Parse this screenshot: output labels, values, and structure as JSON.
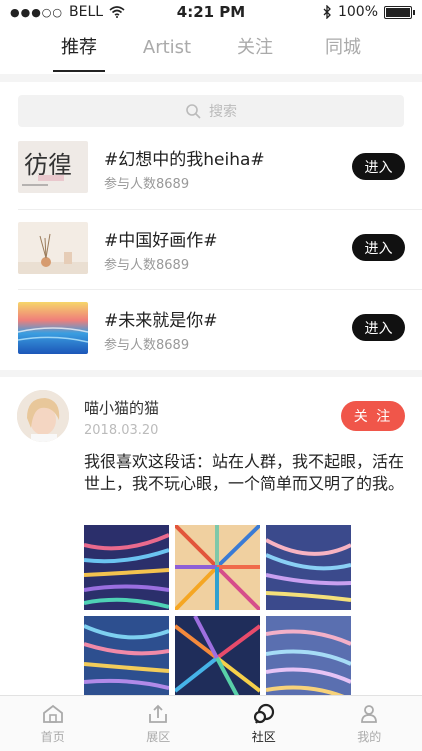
{
  "status": {
    "carrier": "BELL",
    "time": "4:21 PM",
    "battery": "100%"
  },
  "tabs": [
    {
      "label": "推荐",
      "active": true
    },
    {
      "label": "Artist",
      "active": false
    },
    {
      "label": "关注",
      "active": false
    },
    {
      "label": "同城",
      "active": false
    }
  ],
  "search": {
    "placeholder": "搜索"
  },
  "topics": [
    {
      "title": "#幻想中的我heiha#",
      "participants": "参与人数8689",
      "button": "进入"
    },
    {
      "title": "#中国好画作#",
      "participants": "参与人数8689",
      "button": "进入"
    },
    {
      "title": "#未来就是你#",
      "participants": "参与人数8689",
      "button": "进入"
    }
  ],
  "post": {
    "user": "喵小猫的猫",
    "date": "2018.03.20",
    "follow": "关 注",
    "text": "我很喜欢这段话：站在人群，我不起眼，活在世上，我不玩心眼，一个简单而又明了的我。"
  },
  "nav": [
    {
      "label": "首页",
      "icon": "home-icon"
    },
    {
      "label": "展区",
      "icon": "upload-icon"
    },
    {
      "label": "社区",
      "icon": "chat-icon"
    },
    {
      "label": "我的",
      "icon": "user-icon"
    }
  ],
  "colors": {
    "accent": "#f0564a",
    "dark": "#111111"
  }
}
